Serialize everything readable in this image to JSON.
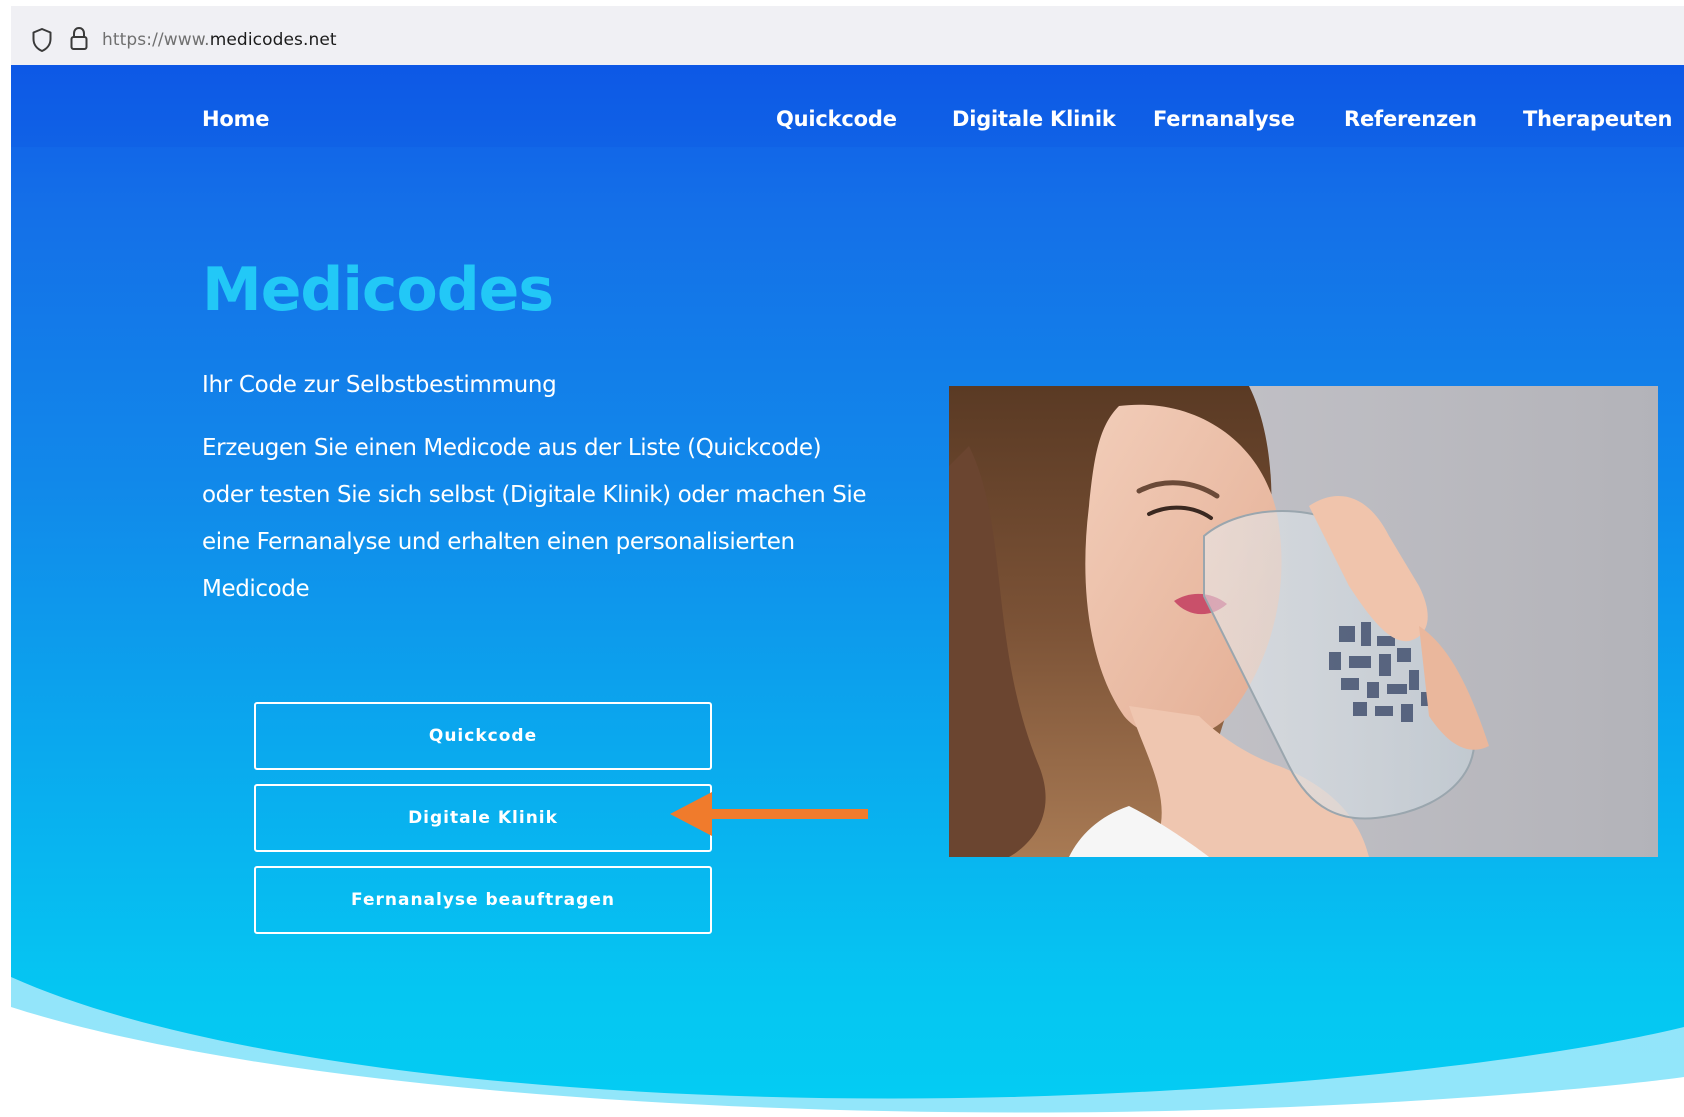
{
  "browser": {
    "url_protocol": "https://www.",
    "url_domain": "medicodes.net"
  },
  "nav": {
    "home": "Home",
    "items": [
      "Quickcode",
      "Digitale Klinik",
      "Fernanalyse",
      "Referenzen",
      "Therapeuten"
    ]
  },
  "hero": {
    "title": "Medicodes",
    "subtitle": "Ihr Code zur Selbstbestimmung",
    "description_lines": [
      "Erzeugen Sie einen Medicode aus der Liste (Quickcode)",
      "oder testen Sie sich selbst (Digitale Klinik) oder machen Sie",
      "eine Fernanalyse und erhalten einen personalisierten",
      "Medicode"
    ],
    "buttons": [
      "Quickcode",
      "Digitale Klinik",
      "Fernanalyse beauftragen"
    ]
  },
  "icons": {
    "shield": "shield-icon",
    "lock": "lock-icon",
    "arrow": "arrow-left-annotation-icon"
  },
  "colors": {
    "nav_blue": "#0f5ce8",
    "hero_cyan": "#04cdf3",
    "title": "#22c8f7",
    "arrow": "#f07b2c"
  }
}
